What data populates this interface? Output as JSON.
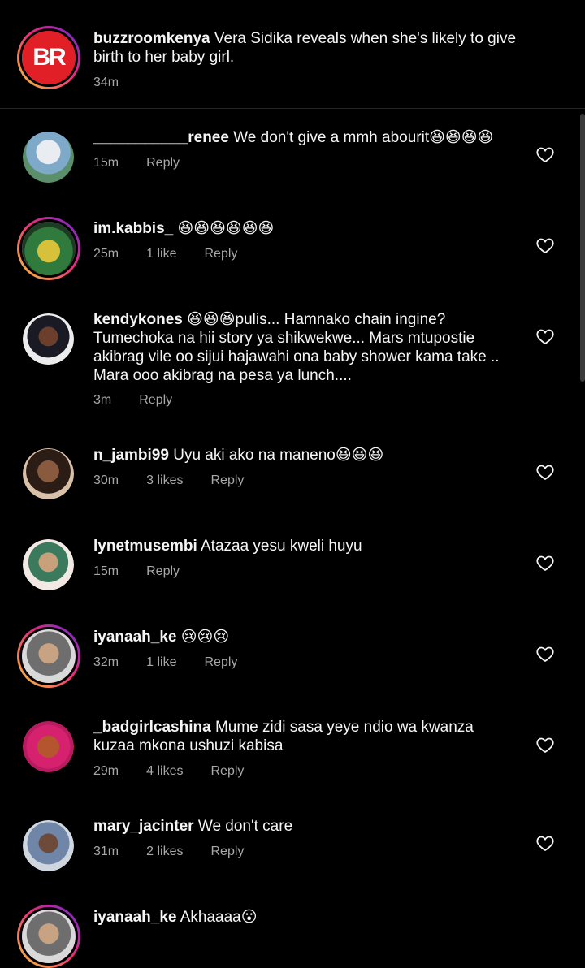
{
  "caption": {
    "username": "buzzroomkenya",
    "text": "Vera Sidika reveals when she's likely to give birth to her baby girl.",
    "time": "34m",
    "avatar_logo_text": "BR"
  },
  "comments": [
    {
      "username": "___________renee",
      "text": "We don't give a mmh abourit😆😆😆😆",
      "time": "15m",
      "likes": "",
      "reply": "Reply"
    },
    {
      "username": "im.kabbis_",
      "text": "😆😆😆😆😆😆",
      "time": "25m",
      "likes": "1 like",
      "reply": "Reply"
    },
    {
      "username": "kendykones",
      "text": "😆😆😆pulis... Hamnako chain ingine? Tumechoka na hii story ya shikwekwe... Mars mtupostie akibrag vile oo sijui hajawahi ona baby shower kama take .. Mara ooo akibrag na pesa ya lunch....",
      "time": "3m",
      "likes": "",
      "reply": "Reply"
    },
    {
      "username": "n_jambi99",
      "text": "Uyu aki ako na maneno😆😆😆",
      "time": "30m",
      "likes": "3 likes",
      "reply": "Reply"
    },
    {
      "username": "lynetmusembi",
      "text": "Atazaa yesu kweli huyu",
      "time": "15m",
      "likes": "",
      "reply": "Reply"
    },
    {
      "username": "iyanaah_ke",
      "text": "😢😢😢",
      "time": "32m",
      "likes": "1 like",
      "reply": "Reply"
    },
    {
      "username": "_badgirlcashina",
      "text": "Mume zidi sasa yeye ndio wa kwanza kuzaa mkona ushuzi kabisa",
      "time": "29m",
      "likes": "4 likes",
      "reply": "Reply"
    },
    {
      "username": "mary_jacinter",
      "text": "We don't care",
      "time": "31m",
      "likes": "2 likes",
      "reply": "Reply"
    },
    {
      "username": "iyanaah_ke",
      "text": "Akhaaaa😮",
      "time": "",
      "likes": "",
      "reply": ""
    }
  ],
  "colors": {
    "background": "#000000",
    "text": "#f5f5f5",
    "meta": "#a8a8a8",
    "brand_red": "#e02026"
  },
  "icons": {
    "like": "heart-outline-icon"
  }
}
